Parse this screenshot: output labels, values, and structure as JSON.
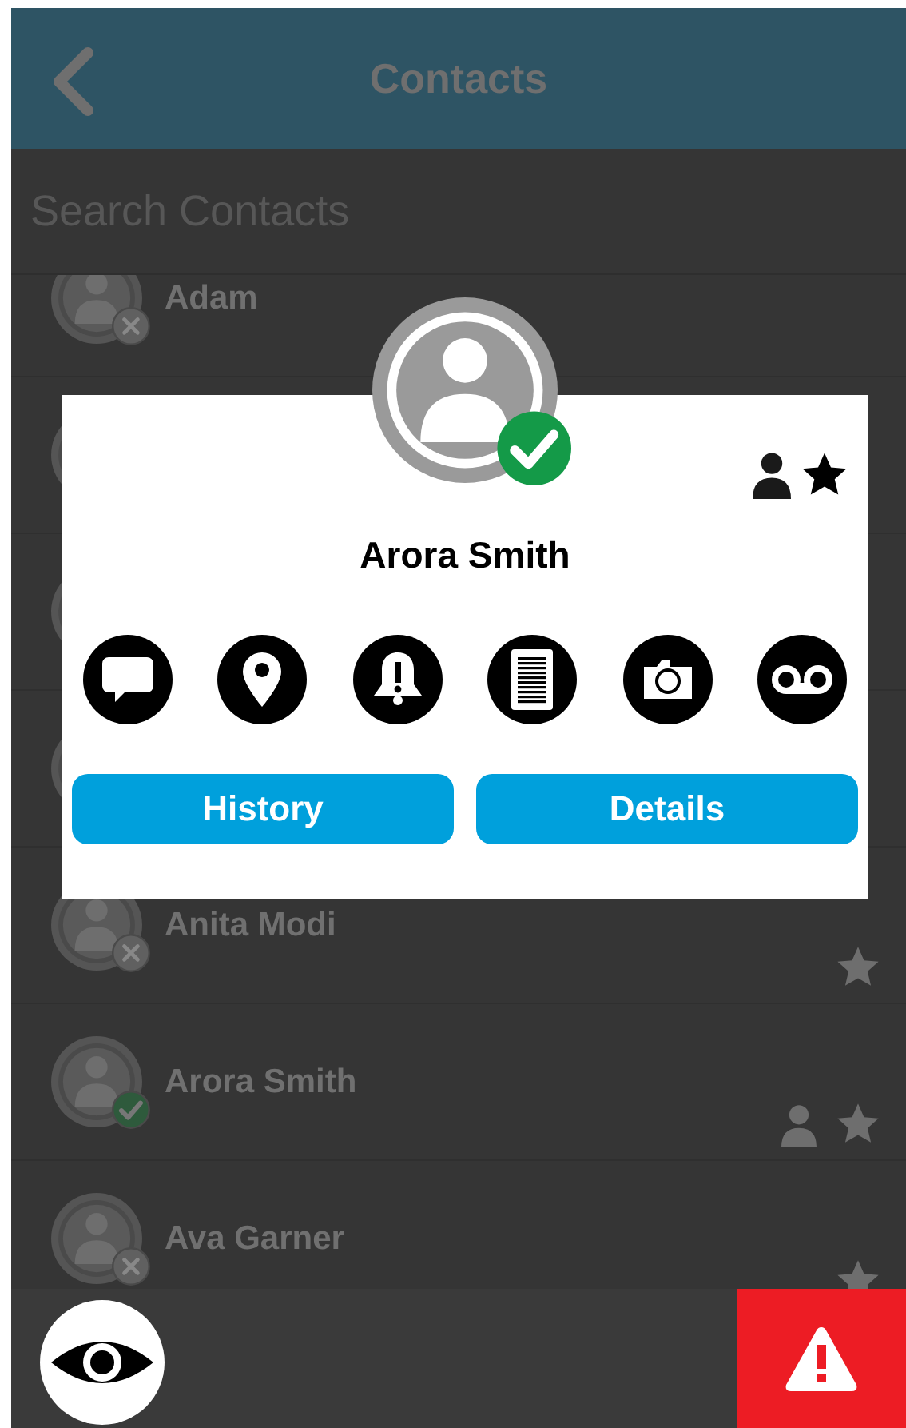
{
  "header": {
    "title": "Contacts"
  },
  "search": {
    "placeholder": "Search Contacts"
  },
  "contacts": [
    {
      "kind": "entry",
      "name": "Adam",
      "online": false,
      "is_contact": false,
      "favorite": false
    },
    {
      "kind": "covered"
    },
    {
      "kind": "covered"
    },
    {
      "kind": "covered"
    },
    {
      "kind": "entry",
      "name": "Anita Modi",
      "online": false,
      "is_contact": false,
      "favorite": true
    },
    {
      "kind": "entry",
      "name": "Arora Smith",
      "online": true,
      "is_contact": true,
      "favorite": true
    },
    {
      "kind": "entry",
      "name": "Ava Garner",
      "online": false,
      "is_contact": false,
      "favorite": true
    }
  ],
  "popup": {
    "name": "Arora Smith",
    "online": true,
    "is_contact": true,
    "favorite": true,
    "actions": [
      {
        "kind": "chat"
      },
      {
        "kind": "location"
      },
      {
        "kind": "alert"
      },
      {
        "kind": "notes"
      },
      {
        "kind": "camera"
      },
      {
        "kind": "voicemail"
      }
    ],
    "buttons": [
      "History",
      "Details"
    ]
  }
}
